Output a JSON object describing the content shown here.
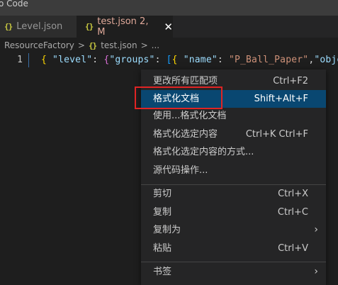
{
  "titlebar": {
    "text": "o Code"
  },
  "tabs": [
    {
      "icon": "{}",
      "label": "Level.json"
    },
    {
      "icon": "{}",
      "label": "test.json 2, M",
      "close": "✕"
    }
  ],
  "breadcrumb": {
    "folder": "ResourceFactory",
    "sep1": ">",
    "file_icon": "{}",
    "file": "test.json",
    "sep2": ">",
    "more": "..."
  },
  "editor": {
    "line_number": "1",
    "tokens": {
      "t1": "{",
      "t2": " \"level\"",
      "t3": ": ",
      "t4": "{",
      "t5": "\"groups\"",
      "t6": ": ",
      "t7": "[",
      "t8": "{",
      "t9": " \"name\"",
      "t10": ": ",
      "t11": "\"P_Ball_Paper\"",
      "t12": ",",
      "t13": "\"object"
    }
  },
  "context_menu": {
    "items": [
      {
        "label": "更改所有匹配项",
        "shortcut": "Ctrl+F2"
      },
      {
        "label": "格式化文档",
        "shortcut": "Shift+Alt+F",
        "active": true
      },
      {
        "label": "使用...格式化文档",
        "shortcut": ""
      },
      {
        "label": "格式化选定内容",
        "shortcut": "Ctrl+K Ctrl+F"
      },
      {
        "label": "格式化选定内容的方式...",
        "shortcut": ""
      },
      {
        "label": "源代码操作...",
        "shortcut": ""
      },
      {
        "label": "剪切",
        "shortcut": "Ctrl+X"
      },
      {
        "label": "复制",
        "shortcut": "Ctrl+C"
      },
      {
        "label": "复制为",
        "shortcut": "",
        "submenu": "›"
      },
      {
        "label": "粘贴",
        "shortcut": "Ctrl+V"
      },
      {
        "label": "书签",
        "shortcut": "",
        "submenu": "›"
      }
    ]
  },
  "colors": {
    "editor_bg": "#1e1e1e",
    "menu_bg": "#252526",
    "menu_active_bg": "#094771",
    "highlight_box": "#e02424",
    "modified_tab_text": "#e0a99a"
  }
}
